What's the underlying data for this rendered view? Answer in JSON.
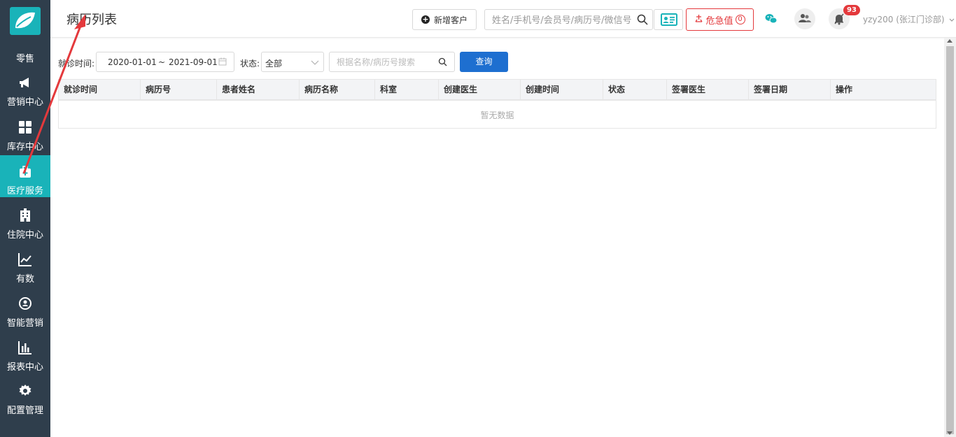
{
  "sidebar": {
    "items": [
      {
        "label": "零售",
        "icon": "retail-icon"
      },
      {
        "label": "营销中心",
        "icon": "megaphone-icon"
      },
      {
        "label": "库存中心",
        "icon": "grid-icon"
      },
      {
        "label": "医疗服务",
        "icon": "medical-kit-icon",
        "active": true
      },
      {
        "label": "住院中心",
        "icon": "hospital-building-icon"
      },
      {
        "label": "有数",
        "icon": "trend-chart-icon"
      },
      {
        "label": "智能营销",
        "icon": "people-network-icon"
      },
      {
        "label": "报表中心",
        "icon": "bar-chart-icon"
      },
      {
        "label": "配置管理",
        "icon": "gear-icon"
      }
    ],
    "active_color": "#19b3b9",
    "bg_color": "#2f3e4c"
  },
  "header": {
    "title": "病历列表",
    "add_customer_label": "新增客户",
    "search_placeholder": "姓名/手机号/会员号/病历号/微信号",
    "danger_label": "危急值",
    "danger_count": "0",
    "notification_badge": "93",
    "user": "yzy200 (张江门诊部)"
  },
  "filters": {
    "visit_time_label": "就诊时间:",
    "date_start": "2020-01-01",
    "date_sep": "~",
    "date_end": "2021-09-01",
    "status_label": "状态:",
    "status_value": "全部",
    "keyword_placeholder": "根据名称/病历号搜索",
    "query_label": "查询"
  },
  "table": {
    "columns": [
      "就诊时间",
      "病历号",
      "患者姓名",
      "病历名称",
      "科室",
      "创建医生",
      "创建时间",
      "状态",
      "签署医生",
      "签署日期",
      "操作"
    ],
    "empty_text": "暂无数据"
  },
  "colors": {
    "primary": "#1e6fd0",
    "danger": "#e4393c",
    "teal": "#19b3b9"
  }
}
